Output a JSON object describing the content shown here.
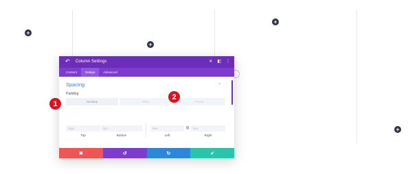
{
  "modal": {
    "title": "Column Settings",
    "tabs": [
      {
        "label": "Content"
      },
      {
        "label": "Design"
      },
      {
        "label": "Advanced"
      }
    ],
    "section": {
      "title": "Spacing"
    },
    "field_label": "Padding",
    "device_tabs": [
      {
        "label": "Desktop"
      },
      {
        "label": "Tablet"
      },
      {
        "label": "Phone"
      }
    ],
    "inputs": {
      "top": {
        "placeholder": "15px",
        "caption": "Top"
      },
      "bottom": {
        "placeholder": "0px",
        "caption": "Bottom"
      },
      "left": {
        "placeholder": "5vw",
        "caption": "Left"
      },
      "right": {
        "placeholder": "5vw",
        "caption": "Right"
      }
    },
    "footer_buttons": [
      {
        "name": "discard",
        "icon": "close-icon",
        "glyph": "✖",
        "color": "#ef5555"
      },
      {
        "name": "undo",
        "icon": "undo-icon",
        "glyph": "↺",
        "color": "#7e3bd0"
      },
      {
        "name": "redo",
        "icon": "redo-icon",
        "glyph": "↻",
        "color": "#2b87da"
      },
      {
        "name": "save",
        "icon": "check-icon",
        "glyph": "✔",
        "color": "#29c4a9"
      }
    ]
  },
  "step_badges": [
    {
      "label": "1"
    },
    {
      "label": "2"
    }
  ],
  "colors": {
    "header": "#6c2eb9",
    "tabs": "#7e3bd0",
    "accent_blue": "#2b87da",
    "badge_red": "#e0101f"
  }
}
